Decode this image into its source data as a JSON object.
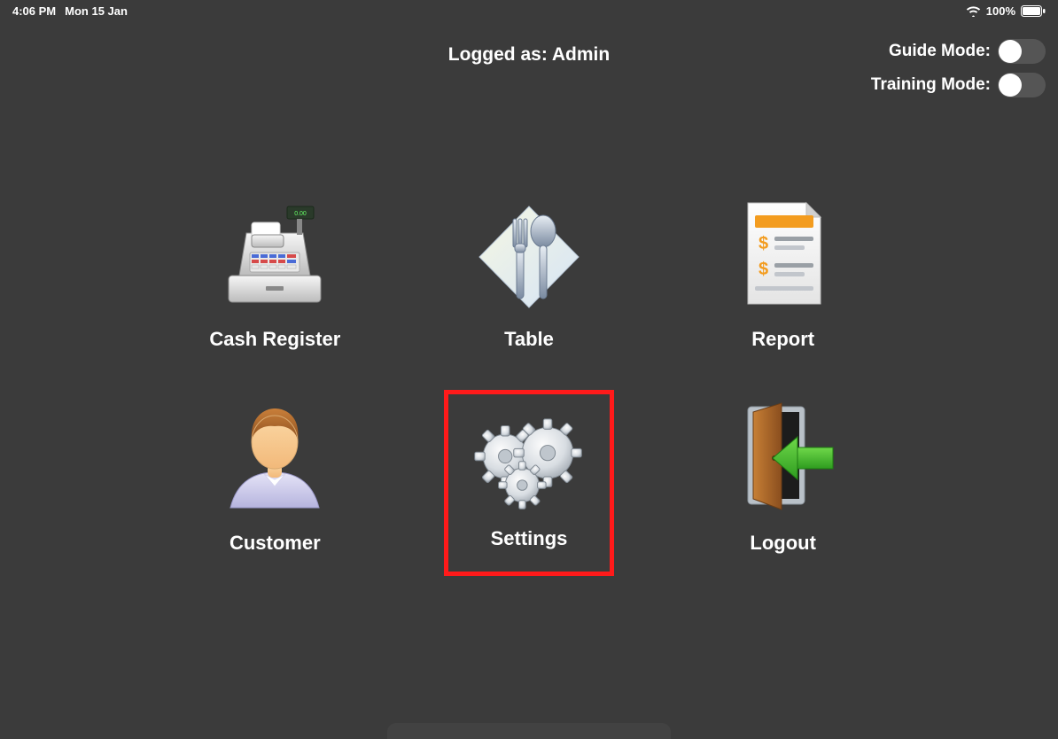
{
  "status": {
    "time": "4:06 PM",
    "date": "Mon 15 Jan",
    "battery_pct": "100%"
  },
  "header": {
    "logged_as_prefix": "Logged as: ",
    "logged_as_user": "Admin",
    "guide_label": "Guide Mode:",
    "training_label": "Training Mode:"
  },
  "tiles": {
    "cash_register": "Cash Register",
    "table": "Table",
    "report": "Report",
    "customer": "Customer",
    "settings": "Settings",
    "logout": "Logout"
  }
}
